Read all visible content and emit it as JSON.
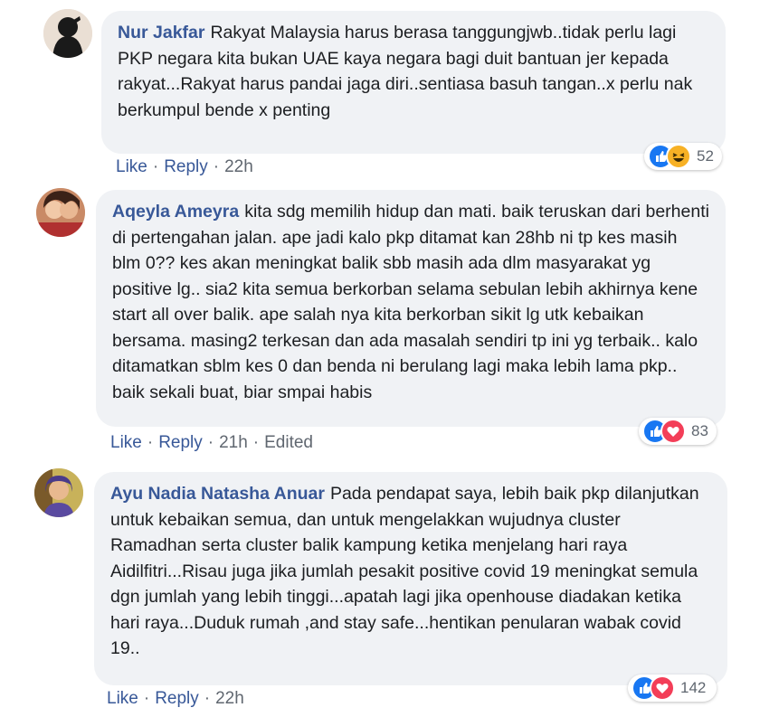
{
  "comments": [
    {
      "author": "Nur Jakfar",
      "text": "Rakyat Malaysia harus berasa tanggungjwb..tidak perlu lagi PKP negara kita bukan UAE kaya negara bagi duit bantuan jer kepada rakyat...Rakyat harus pandai jaga diri..sentiasa basuh tangan..x perlu nak berkumpul bende x penting",
      "reactions": {
        "icons": [
          "like-icon",
          "haha-icon"
        ],
        "count": "52"
      },
      "like_label": "Like",
      "reply_label": "Reply",
      "time": "22h",
      "edited": ""
    },
    {
      "author": "Aqeyla Ameyra",
      "text": "kita sdg memilih hidup dan mati. baik teruskan dari berhenti di pertengahan jalan. ape jadi kalo pkp ditamat kan 28hb ni tp kes masih blm 0?? kes akan meningkat balik sbb masih ada dlm masyarakat yg positive lg.. sia2 kita semua berkorban selama sebulan lebih akhirnya kene start all over balik. ape salah nya kita berkorban sikit lg utk kebaikan bersama. masing2 terkesan dan ada masalah sendiri tp ini yg terbaik.. kalo ditamatkan sblm kes 0 dan benda ni berulang lagi maka lebih lama pkp.. baik sekali buat, biar smpai habis",
      "reactions": {
        "icons": [
          "like-icon",
          "love-icon"
        ],
        "count": "83"
      },
      "like_label": "Like",
      "reply_label": "Reply",
      "time": "21h",
      "edited": "Edited"
    },
    {
      "author": "Ayu Nadia Natasha Anuar",
      "text": "Pada pendapat saya, lebih baik pkp dilanjutkan untuk kebaikan semua, dan untuk mengelakkan wujudnya cluster Ramadhan serta cluster balik kampung ketika menjelang hari raya Aidilfitri...Risau juga jika jumlah pesakit positive covid 19 meningkat semula dgn jumlah yang lebih tinggi...apatah lagi jika openhouse diadakan ketika hari raya...Duduk rumah ,and stay safe...hentikan penularan wabak covid 19..",
      "reactions": {
        "icons": [
          "like-icon",
          "love-icon"
        ],
        "count": "142"
      },
      "like_label": "Like",
      "reply_label": "Reply",
      "time": "22h",
      "edited": ""
    }
  ],
  "colors": {
    "author": "#385898",
    "bubble": "#f0f2f5",
    "like": "#1877f2",
    "love": "#f33e58",
    "haha": "#f7b125"
  }
}
